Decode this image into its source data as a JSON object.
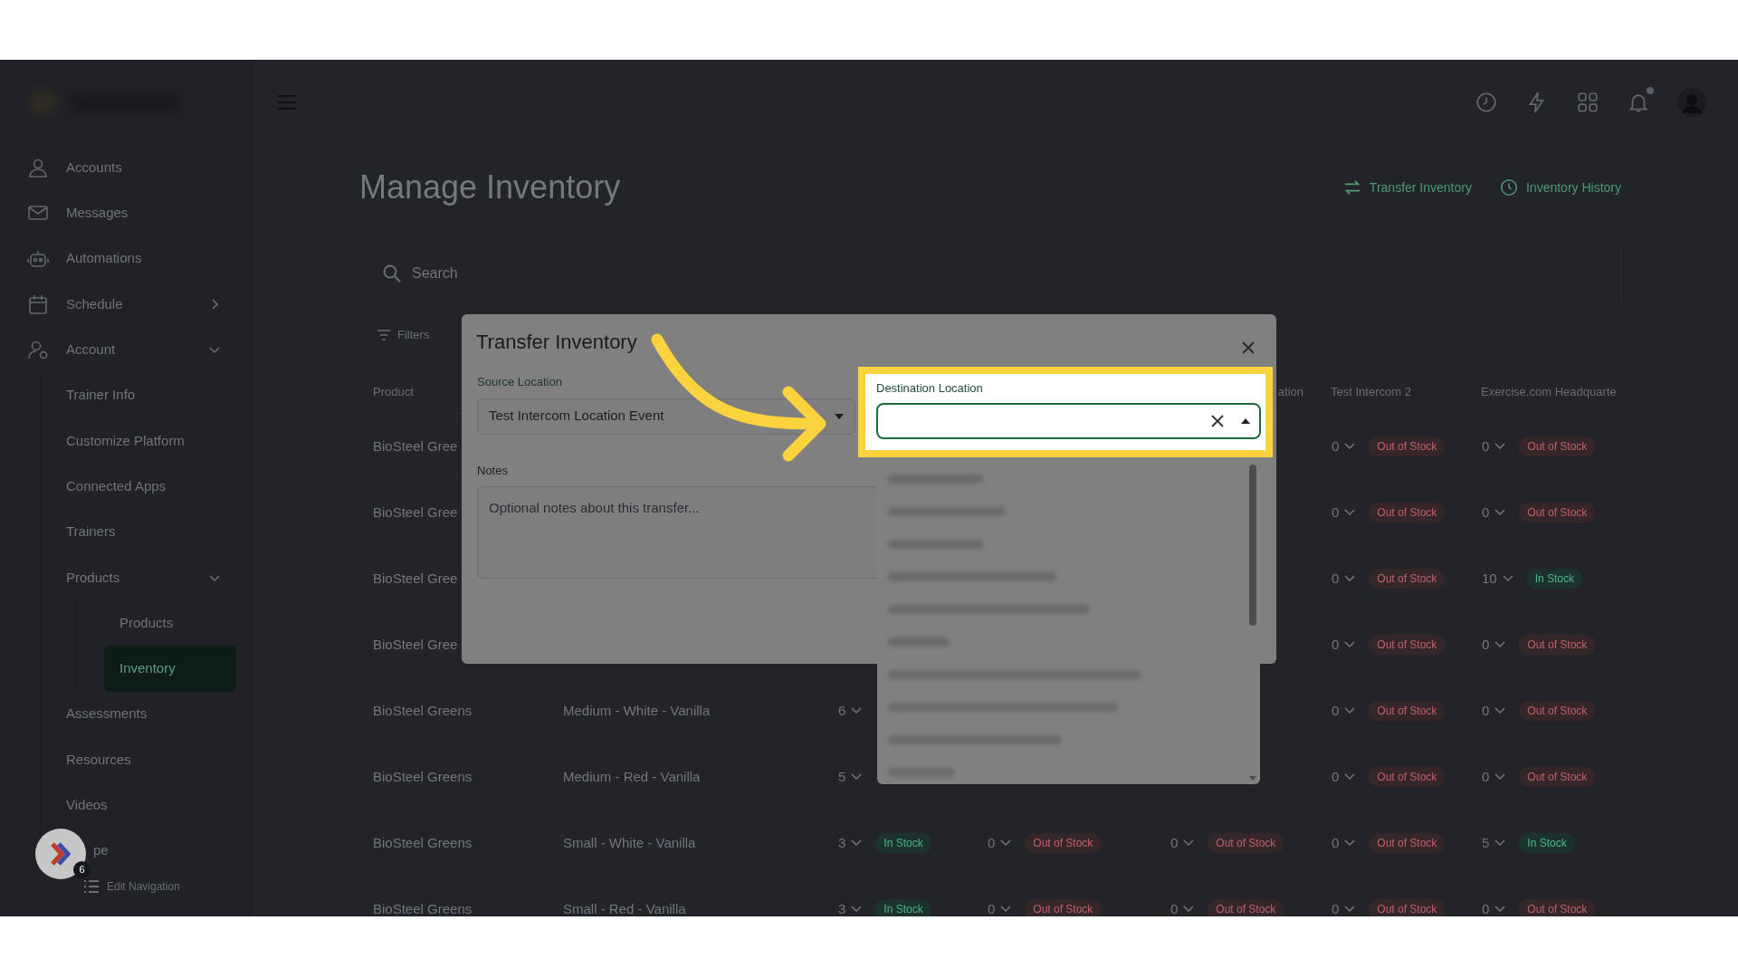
{
  "sidebar": {
    "items": [
      {
        "label": "Accounts",
        "selected": false
      },
      {
        "label": "Messages",
        "selected": false
      },
      {
        "label": "Automations",
        "selected": false
      },
      {
        "label": "Schedule",
        "selected": false,
        "expanded": false
      },
      {
        "label": "Account",
        "selected": false,
        "expanded": true,
        "children": [
          {
            "label": "Trainer Info",
            "selected": false
          },
          {
            "label": "Customize Platform",
            "selected": false
          },
          {
            "label": "Connected Apps",
            "selected": false
          },
          {
            "label": "Trainers",
            "selected": false
          },
          {
            "label": "Products",
            "selected": false,
            "expanded": true,
            "children": [
              {
                "label": "Products",
                "selected": false
              },
              {
                "label": "Inventory",
                "selected": true
              }
            ]
          },
          {
            "label": "Assessments",
            "selected": false
          },
          {
            "label": "Resources",
            "selected": false
          },
          {
            "label": "Videos",
            "selected": false
          },
          {
            "label": "pe",
            "selected": false,
            "kind": "partial"
          }
        ]
      }
    ],
    "edit_navigation": "Edit Navigation"
  },
  "topbar": {
    "notifications": {
      "unread": true
    }
  },
  "page": {
    "title": "Manage Inventory",
    "actions": [
      "Transfer Inventory",
      "Inventory History"
    ],
    "search": {
      "placeholder": "Search"
    },
    "filters": "Filters"
  },
  "table": {
    "header": {
      "product": "Product",
      "col_5": "ation",
      "col_6": "Test Intercom 2",
      "col_7": "Exercise.com Headquarte"
    },
    "rows": [
      {
        "product": "BioSteel Gree",
        "col_6": {
          "qty": "0",
          "status": "Out of Stock",
          "in_stock": false
        },
        "col_7": {
          "qty": "0",
          "status": "Out of Stock",
          "in_stock": false
        }
      },
      {
        "product": "BioSteel Gree",
        "col_6": {
          "qty": "0",
          "status": "Out of Stock",
          "in_stock": false
        },
        "col_7": {
          "qty": "0",
          "status": "Out of Stock",
          "in_stock": false
        }
      },
      {
        "product": "BioSteel Gree",
        "col_6": {
          "qty": "0",
          "status": "Out of Stock",
          "in_stock": false
        },
        "col_7": {
          "qty": "10",
          "status": "In Stock",
          "in_stock": true
        }
      },
      {
        "product": "BioSteel Gree",
        "col_6": {
          "qty": "0",
          "status": "Out of Stock",
          "in_stock": false
        },
        "col_7": {
          "qty": "0",
          "status": "Out of Stock",
          "in_stock": false
        }
      },
      {
        "product": "BioSteel Greens",
        "variant": "Medium - White - Vanilla",
        "col_3": {
          "qty": "6"
        },
        "col_6": {
          "qty": "0",
          "status": "Out of Stock",
          "in_stock": false
        },
        "col_7": {
          "qty": "0",
          "status": "Out of Stock",
          "in_stock": false
        }
      },
      {
        "product": "BioSteel Greens",
        "variant": "Medium - Red - Vanilla",
        "col_3": {
          "qty": "5"
        },
        "col_6": {
          "qty": "0",
          "status": "Out of Stock",
          "in_stock": false
        },
        "col_7": {
          "qty": "0",
          "status": "Out of Stock",
          "in_stock": false
        }
      },
      {
        "product": "BioSteel Greens",
        "variant": "Small - White - Vanilla",
        "col_3": {
          "qty": "3",
          "status": "In Stock",
          "in_stock": true
        },
        "col_4": {
          "qty": "0",
          "status": "Out of Stock",
          "in_stock": false
        },
        "col_5": {
          "qty": "0",
          "status": "Out of Stock",
          "in_stock": false
        },
        "col_6": {
          "qty": "0",
          "status": "Out of Stock",
          "in_stock": false
        },
        "col_7": {
          "qty": "5",
          "status": "In Stock",
          "in_stock": true
        }
      },
      {
        "product": "BioSteel Greens",
        "variant": "Small - Red - Vanilla",
        "col_3": {
          "qty": "3",
          "status": "In Stock",
          "in_stock": true
        },
        "col_4": {
          "qty": "0",
          "status": "Out of Stock",
          "in_stock": false
        },
        "col_5": {
          "qty": "0",
          "status": "Out of Stock",
          "in_stock": false
        },
        "col_6": {
          "qty": "0",
          "status": "Out of Stock",
          "in_stock": false
        },
        "col_7": {
          "qty": "0",
          "status": "Out of Stock",
          "in_stock": false
        }
      }
    ]
  },
  "modal": {
    "title": "Transfer Inventory",
    "source": {
      "label": "Source Location",
      "value": "Test Intercom Location Event"
    },
    "notes": {
      "label": "Notes",
      "placeholder": "Optional notes about this transfer..."
    },
    "destination": {
      "label": "Destination Location",
      "expanded": true,
      "highlighted": true
    }
  },
  "chat": {
    "count": "6"
  }
}
